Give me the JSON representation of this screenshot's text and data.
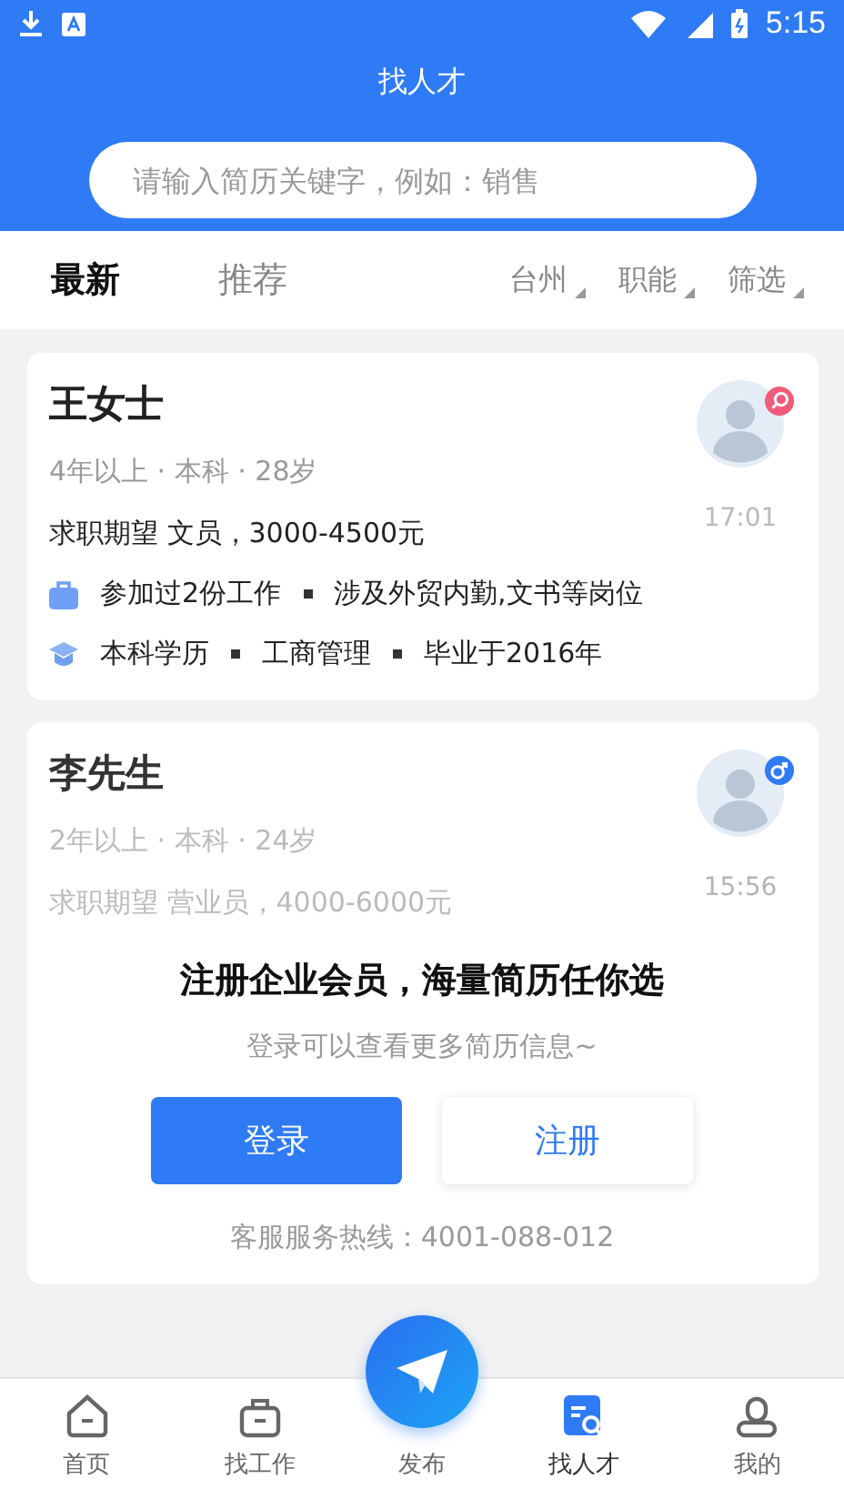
{
  "status_bar": {
    "time": "5:15"
  },
  "header": {
    "title": "找人才"
  },
  "search": {
    "placeholder": "请输入简历关键字，例如：销售"
  },
  "tabs": [
    {
      "label": "最新",
      "selected": true
    },
    {
      "label": "推荐",
      "selected": false
    }
  ],
  "filters": [
    {
      "label": "台州"
    },
    {
      "label": "职能"
    },
    {
      "label": "筛选"
    }
  ],
  "candidates": [
    {
      "name": "王女士",
      "kind": "female",
      "meta": "4年以上 · 本科 · 28岁",
      "expectation": "求职期望 文员，3000-4500元",
      "time": "17:01",
      "faded": false,
      "experience": [
        "参加过2份工作",
        "涉及外贸内勤,文书等岗位"
      ],
      "education": [
        "本科学历",
        "工商管理",
        "毕业于2016年"
      ]
    },
    {
      "name": "李先生",
      "kind": "male",
      "meta": "2年以上 · 本科 · 24岁",
      "expectation": "求职期望 营业员，4000-6000元",
      "time": "15:56",
      "faded": true
    }
  ],
  "promo": {
    "title": "注册企业会员，海量简历任你选",
    "subtitle": "登录可以查看更多简历信息~",
    "login_button": "登录",
    "register_button": "注册",
    "hotline": "客服服务热线：4001-088-012"
  },
  "bottom_nav": [
    {
      "label": "首页",
      "kind": "tab",
      "selected": false
    },
    {
      "label": "找工作",
      "kind": "tab",
      "selected": false
    },
    {
      "label": "发布",
      "kind": "publish",
      "selected": false
    },
    {
      "label": "找人才",
      "kind": "tab",
      "selected": true
    },
    {
      "label": "我的",
      "kind": "tab",
      "selected": false
    }
  ]
}
